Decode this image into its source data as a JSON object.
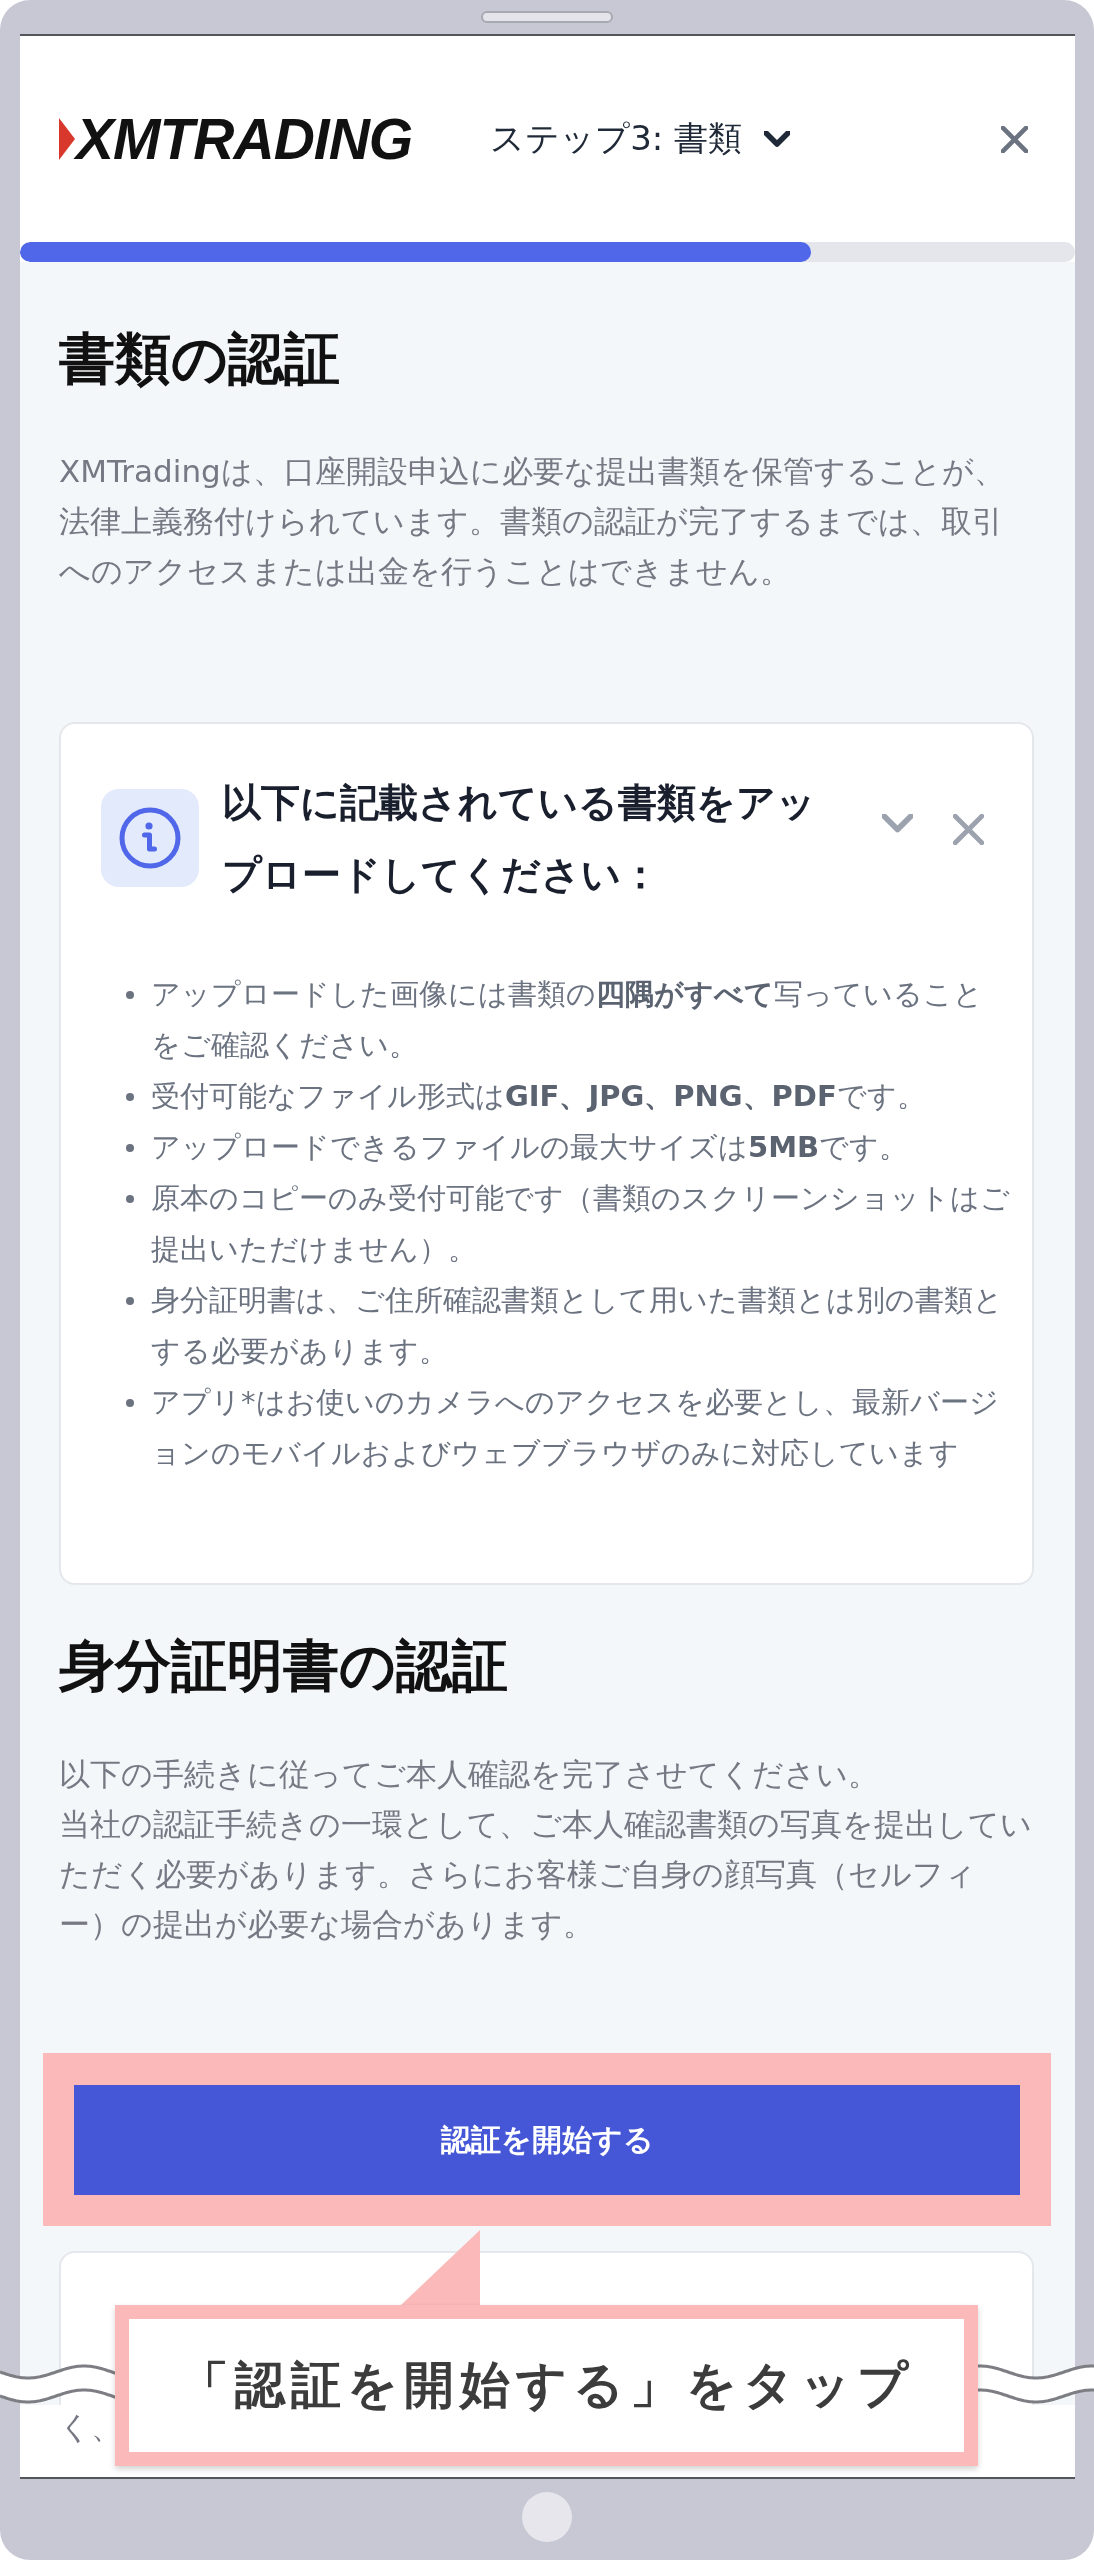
{
  "header": {
    "logo": "XMTRADING",
    "step_label": "ステップ3: 書類"
  },
  "progress": {
    "level": 0.75
  },
  "documents_section": {
    "title": "書類の認証",
    "description": "XMTradingは、口座開設申込に必要な提出書類を保管することが、法律上義務付けられています。書類の認証が完了するまでは、取引へのアクセスまたは出金を行うことはできません。"
  },
  "notice": {
    "title": "以下に記載されている書類をアップロードしてください：",
    "expanded": true,
    "items": [
      "アップロードした画像には書類の**四隅がすべて**写っていることをご確認ください。",
      "受付可能なファイル形式は**GIF、JPG、PNG、PDF**です。",
      "アップロードできるファイルの最大サイズは**5MB**です。",
      "原本のコピーのみ受付可能です（書類のスクリーンショットはご提出いただけません）。",
      "身分証明書は、ご住所確認書類として用いた書類とは別の書類とする必要があります。",
      "アプリ*はお使いのカメラへのアクセスを必要とし、最新バージョンのモバイルおよびウェブブラウザのみに対応しています"
    ]
  },
  "identity_section": {
    "title": "身分証明書の認証",
    "paragraphs": [
      "以下の手続きに従ってご本人確認を完了させてください。",
      "当社の認証手続きの一環として、ご本人確認書類の写真を提出していただく必要があります。さらにお客様ご自身の顔写真（セルフィー）の提出が必要な場合があります。"
    ]
  },
  "start_button": {
    "label": "認証を開始する",
    "highlighted": true
  },
  "continued_content": {
    "text": "く、"
  },
  "callout": {
    "text": "「認証を開始する」をタップ"
  }
}
